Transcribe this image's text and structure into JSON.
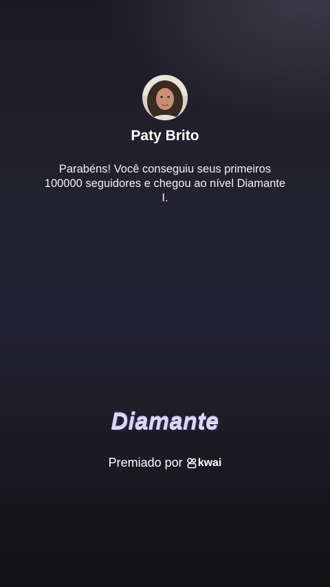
{
  "user": {
    "name": "Paty Brito"
  },
  "message": "Parabéns! Você conseguiu seus primeiros 100000 seguidores e chegou ao nível Diamante I.",
  "tier": {
    "label": "Diamante"
  },
  "awarded": {
    "prefix": "Premiado por",
    "brand": "kwai",
    "brand_icon": "kwai-logo-icon"
  }
}
